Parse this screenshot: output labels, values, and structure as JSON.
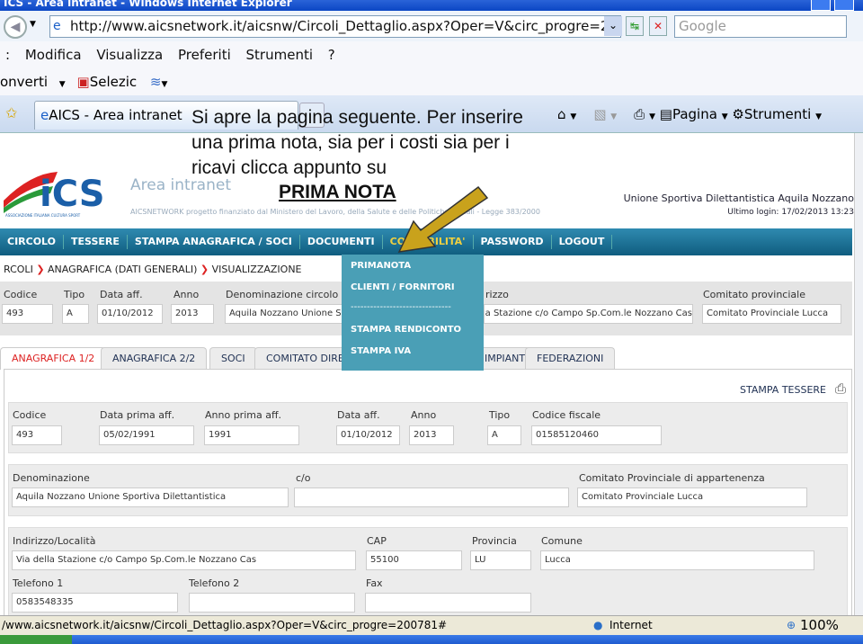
{
  "window": {
    "title": "ICS - Area intranet - Windows Internet Explorer"
  },
  "address": {
    "url": "http://www.aicsnetwork.it/aicsnw/Circoli_Dettaglio.aspx?Oper=V&circ_progre=200781",
    "search_placeholder": "Google"
  },
  "menu": [
    "Modifica",
    "Visualizza",
    "Preferiti",
    "Strumenti",
    "?"
  ],
  "toolbar": {
    "converti": "onverti",
    "selezic": "Selezic"
  },
  "tab": {
    "label": "AICS - Area intranet"
  },
  "tools": {
    "pagina": "Pagina",
    "strumenti": "Strumenti"
  },
  "annotation": {
    "line1": "Si apre la pagina seguente. Per inserire",
    "line2": "una prima nota, sia per i costi sia per i",
    "line3": "ricavi clicca appunto su",
    "emphasis": "PRIMA NOTA",
    "arrow_color": "#c9a21c"
  },
  "header": {
    "logo": "AICS",
    "logo_sub": "ASSOCIAZIONE ITALIANA CULTURA SPORT",
    "area": "Area intranet",
    "subline": "AICSNETWORK progetto finanziato dal Ministero del Lavoro, della Salute e delle Politiche Sociali - Legge 383/2000",
    "org": "Unione Sportiva Dilettantistica Aquila Nozzano",
    "login": "Ultimo login: 17/02/2013 13:23"
  },
  "nav": [
    "CIRCOLO",
    "TESSERE",
    "STAMPA ANAGRAFICA / SOCI",
    "DOCUMENTI",
    "CONTABILITA'",
    "PASSWORD",
    "LOGOUT"
  ],
  "dropdown": [
    "PRIMANOTA",
    "CLIENTI / FORNITORI",
    "-------------------------------",
    "STAMPA RENDICONTO",
    "STAMPA IVA"
  ],
  "breadcrumb": [
    "RCOLI",
    "ANAGRAFICA (DATI GENERALI)",
    "VISUALIZZAZIONE"
  ],
  "summary": {
    "labels": [
      "Codice",
      "Tipo",
      "Data aff.",
      "Anno",
      "Denominazione circolo",
      "rizzo",
      "Comitato provinciale"
    ],
    "values": [
      "493",
      "A",
      "01/10/2012",
      "2013",
      "Aquila Nozzano Unione Sportiva Dilettantistica",
      "Via della Stazione c/o Campo Sp.Com.le Nozzano Cas",
      "Comitato Provinciale Lucca"
    ]
  },
  "page_tabs": [
    "ANAGRAFICA 1/2",
    "ANAGRAFICA 2/2",
    "SOCI",
    "COMITATO DIRETTIVO",
    "IMPIANTI",
    "FEDERAZIONI"
  ],
  "stampa_tessere": "STAMPA TESSERE",
  "form": {
    "row1": {
      "labels": [
        "Codice",
        "Data prima aff.",
        "Anno prima aff.",
        "Data aff.",
        "Anno",
        "Tipo",
        "Codice fiscale"
      ],
      "values": [
        "493",
        "05/02/1991",
        "1991",
        "01/10/2012",
        "2013",
        "A",
        "01585120460"
      ]
    },
    "row2": {
      "labels": [
        "Denominazione",
        "c/o",
        "Comitato Provinciale di appartenenza"
      ],
      "values": [
        "Aquila Nozzano Unione Sportiva Dilettantistica",
        "",
        "Comitato Provinciale Lucca"
      ]
    },
    "row3": {
      "labels": [
        "Indirizzo/Località",
        "CAP",
        "Provincia",
        "Comune"
      ],
      "values": [
        "Via della Stazione c/o Campo Sp.Com.le Nozzano Cas",
        "55100",
        "LU",
        "Lucca"
      ]
    },
    "row4": {
      "labels": [
        "Telefono 1",
        "Telefono 2",
        "Fax"
      ],
      "values": [
        "0583548335",
        "",
        ""
      ]
    }
  },
  "status": {
    "url": "/www.aicsnetwork.it/aicsnw/Circoli_Dettaglio.aspx?Oper=V&circ_progre=200781#",
    "zone": "Internet",
    "zoom": "100%"
  }
}
